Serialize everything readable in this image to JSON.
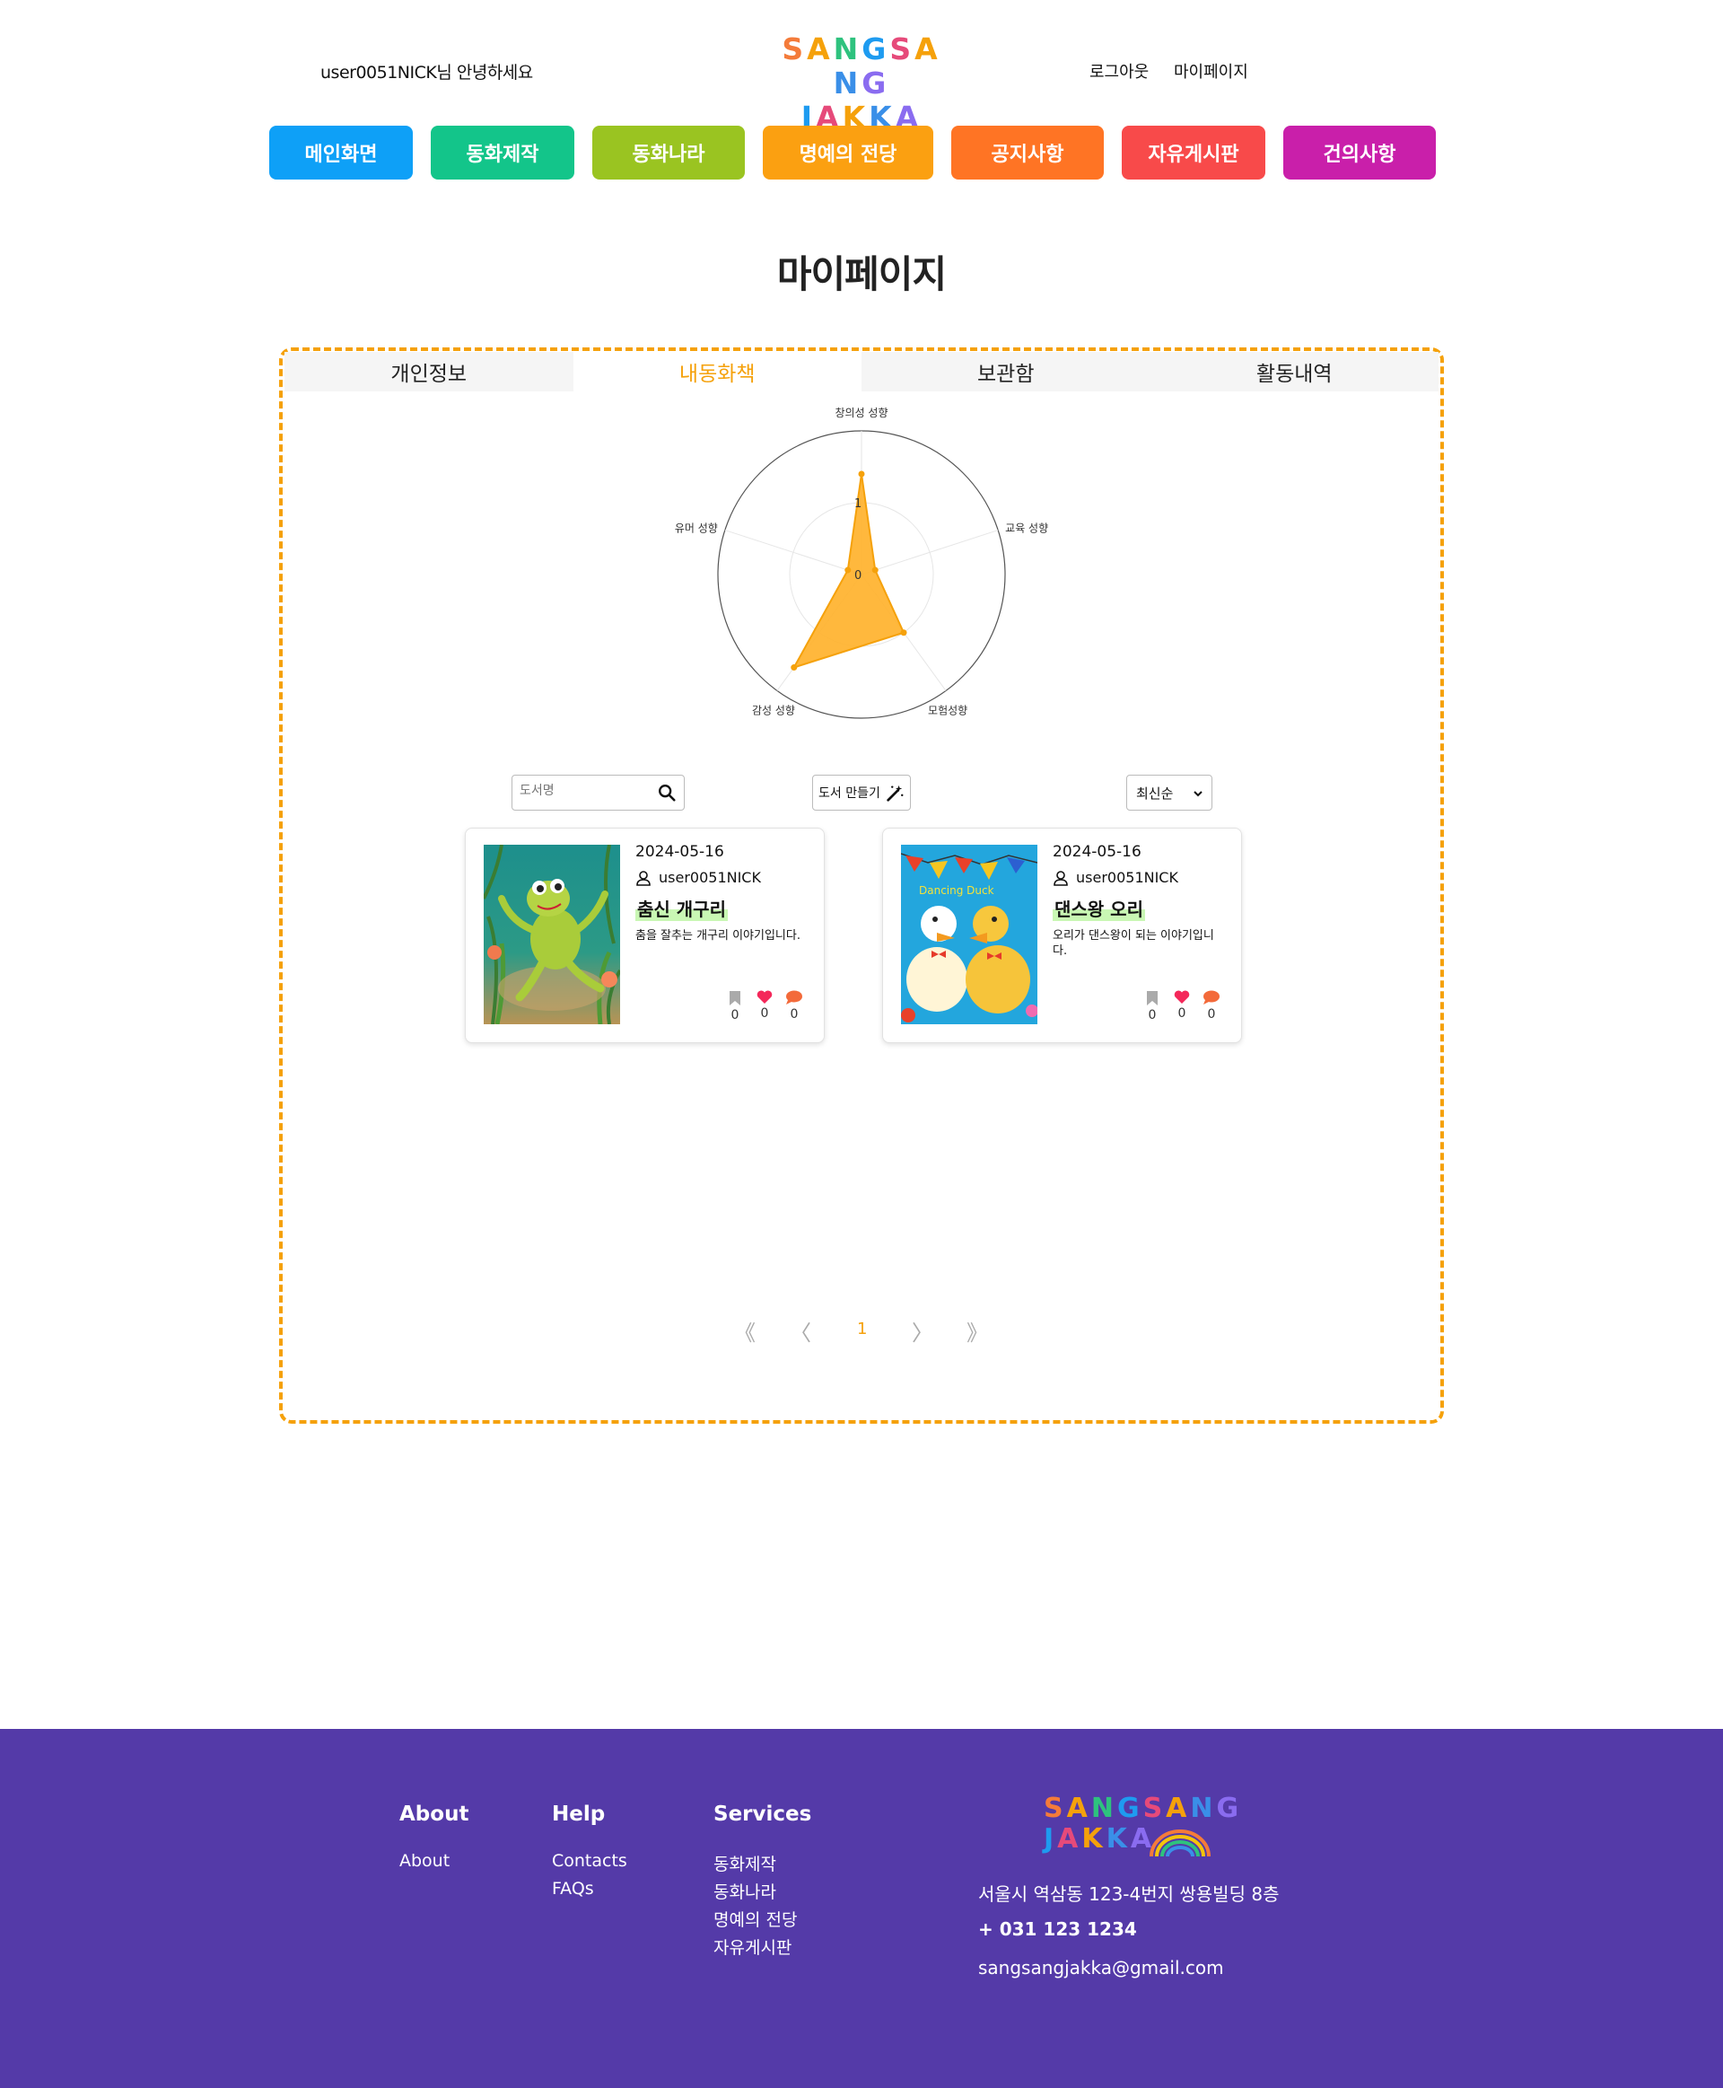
{
  "header": {
    "greeting": "user0051NICK님 안녕하세요",
    "logo_line1": [
      "S",
      "A",
      "N",
      "G",
      "S",
      "A",
      "N",
      "G"
    ],
    "logo_line2": [
      "J",
      "A",
      "K",
      "K",
      "A"
    ],
    "logo_colors": [
      "#f47b3a",
      "#f5a10b",
      "#2ec27e",
      "#1e9bf0",
      "#e64a7a",
      "#f5a10b",
      "#3a8fe8",
      "#8a6cf0"
    ],
    "logout": "로그아웃",
    "mypage": "마이페이지"
  },
  "nav": [
    {
      "label": "메인화면",
      "color": "#0ea0f7"
    },
    {
      "label": "동화제작",
      "color": "#13c58a"
    },
    {
      "label": "동화나라",
      "color": "#9ac421"
    },
    {
      "label": "명예의 전당",
      "color": "#fba011"
    },
    {
      "label": "공지사항",
      "color": "#ff7424"
    },
    {
      "label": "자유게시판",
      "color": "#f84a4a"
    },
    {
      "label": "건의사항",
      "color": "#c91faa"
    }
  ],
  "page_title": "마이페이지",
  "tabs": [
    "개인정보",
    "내동화책",
    "보관함",
    "활동내역"
  ],
  "active_tab": 1,
  "chart_data": {
    "type": "radar",
    "axes": [
      "창의성 성향",
      "교육 성향",
      "모험성향",
      "감성 성향",
      "유머 성향"
    ],
    "values": [
      1.4,
      0.2,
      1.0,
      1.6,
      0.2
    ],
    "tick_labels": [
      "0",
      "1"
    ],
    "fill_color": "#ffb22c",
    "stroke_color": "#f5a10b"
  },
  "controls": {
    "search_placeholder": "도서명",
    "make_book": "도서 만들기",
    "sort_selected": "최신순"
  },
  "books": [
    {
      "date": "2024-05-16",
      "author": "user0051NICK",
      "title": "춤신 개구리",
      "desc": "춤을 잘추는 개구리 이야기입니다.",
      "bookmarks": "0",
      "likes": "0",
      "comments": "0"
    },
    {
      "date": "2024-05-16",
      "author": "user0051NICK",
      "title": "댄스왕 오리",
      "desc": "오리가 댄스왕이 되는 이야기입니다.",
      "bookmarks": "0",
      "likes": "0",
      "comments": "0",
      "cover_text": "Dancing Duck"
    }
  ],
  "pagination": {
    "first": "《",
    "prev": "〈",
    "current": "1",
    "next": "〉",
    "last": "》"
  },
  "footer": {
    "about_title": "About",
    "about_links": [
      "About"
    ],
    "help_title": "Help",
    "help_links": [
      "Contacts",
      "FAQs"
    ],
    "services_title": "Services",
    "services_links": [
      "동화제작",
      "동화나라",
      "명예의 전당",
      "자유게시판"
    ],
    "address": "서울시 역삼동 123-4번지 쌍용빌딩 8층",
    "phone": "+ 031 123 1234",
    "email": "sangsangjakka@gmail.com"
  }
}
